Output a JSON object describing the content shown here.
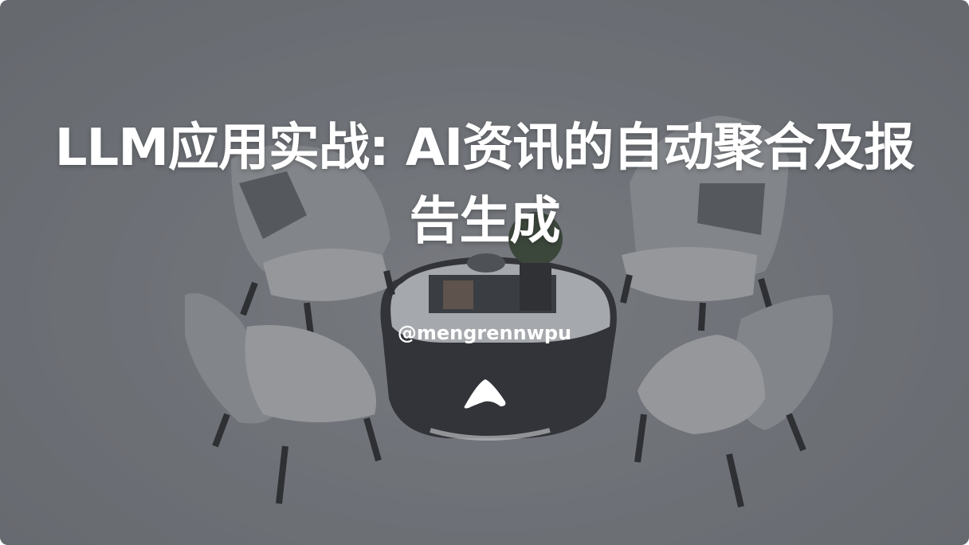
{
  "slide": {
    "title": "LLM应用实战: AI资讯的自动聚合及报告生成",
    "author_handle": "@mengrennwpu"
  },
  "colors": {
    "title_text": "#ffffff",
    "background_gray": "#7e8187"
  },
  "icons": {
    "logo": "arrow-up-logo-icon"
  }
}
